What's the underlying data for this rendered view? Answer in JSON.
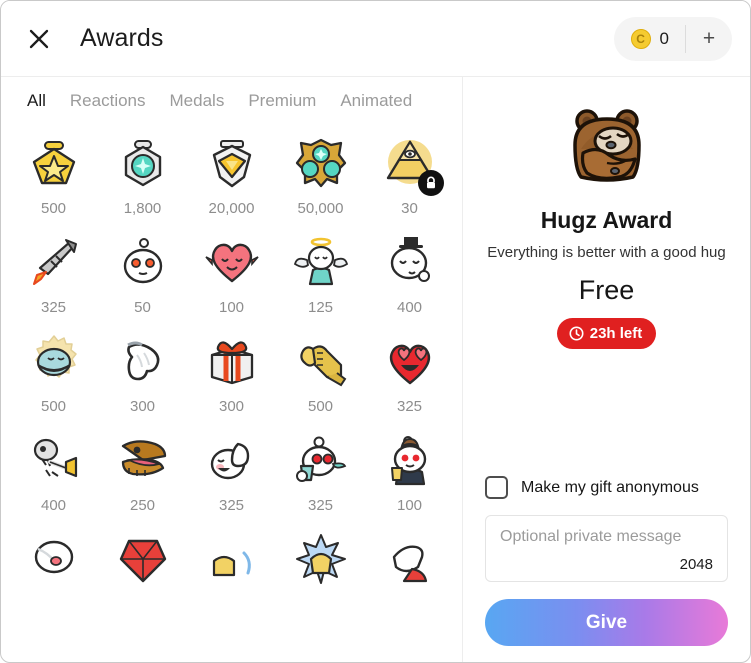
{
  "header": {
    "close_icon": "close-icon",
    "title": "Awards",
    "coin_icon": "coin-icon",
    "coin_symbol": "C",
    "coin_balance": "0",
    "add_coins_label": "+"
  },
  "tabs": [
    {
      "label": "All",
      "active": true
    },
    {
      "label": "Reactions",
      "active": false
    },
    {
      "label": "Medals",
      "active": false
    },
    {
      "label": "Premium",
      "active": false
    },
    {
      "label": "Animated",
      "active": false
    }
  ],
  "awards": [
    {
      "icon": "gold-star-medal-icon",
      "price": "500",
      "locked": false
    },
    {
      "icon": "silver-gem-badge-icon",
      "price": "1,800",
      "locked": false
    },
    {
      "icon": "silver-gold-diamond-medal-icon",
      "price": "20,000",
      "locked": false
    },
    {
      "icon": "gold-gem-cluster-icon",
      "price": "50,000",
      "locked": false
    },
    {
      "icon": "pyramid-eye-icon",
      "price": "30",
      "locked": true
    },
    {
      "icon": "rocket-icon",
      "price": "325",
      "locked": false
    },
    {
      "icon": "snoo-face-icon",
      "price": "50",
      "locked": false
    },
    {
      "icon": "wholesome-heart-icon",
      "price": "100",
      "locked": false
    },
    {
      "icon": "angel-snoo-icon",
      "price": "125",
      "locked": false
    },
    {
      "icon": "sleepy-tophat-snoo-icon",
      "price": "400",
      "locked": false
    },
    {
      "icon": "seal-of-approval-icon",
      "price": "500",
      "locked": false
    },
    {
      "icon": "pointing-hand-icon",
      "price": "300",
      "locked": false
    },
    {
      "icon": "gift-box-icon",
      "price": "300",
      "locked": false
    },
    {
      "icon": "bro-fist-handshake-icon",
      "price": "500",
      "locked": false
    },
    {
      "icon": "heart-eyes-icon",
      "price": "325",
      "locked": false
    },
    {
      "icon": "skeleton-trumpet-icon",
      "price": "400",
      "locked": false
    },
    {
      "icon": "dinosaur-head-icon",
      "price": "250",
      "locked": false
    },
    {
      "icon": "flexing-snoo-icon",
      "price": "325",
      "locked": false
    },
    {
      "icon": "spit-take-snoo-icon",
      "price": "325",
      "locked": false
    },
    {
      "icon": "tuxedo-toast-snoo-icon",
      "price": "100",
      "locked": false
    }
  ],
  "awards_partial_row": [
    {
      "icon": "blushing-snoo-icon"
    },
    {
      "icon": "ruby-gem-icon"
    },
    {
      "icon": "gold-fist-swoosh-icon"
    },
    {
      "icon": "clapping-hands-icon"
    },
    {
      "icon": "thumbs-up-icon"
    }
  ],
  "detail": {
    "art_icon": "hugging-bear-icon",
    "name": "Hugz Award",
    "description": "Everything is better with a good hug",
    "price": "Free",
    "time_icon": "clock-icon",
    "time_left": "23h left",
    "anonymous_label": "Make my gift anonymous",
    "message_placeholder": "Optional private message",
    "message_value": "",
    "message_counter": "2048",
    "give_label": "Give"
  },
  "colors": {
    "accent_red": "#e02020",
    "gradient_start": "#58a7f2",
    "gradient_end": "#e87ad8",
    "coin_yellow": "#f5cb30"
  }
}
